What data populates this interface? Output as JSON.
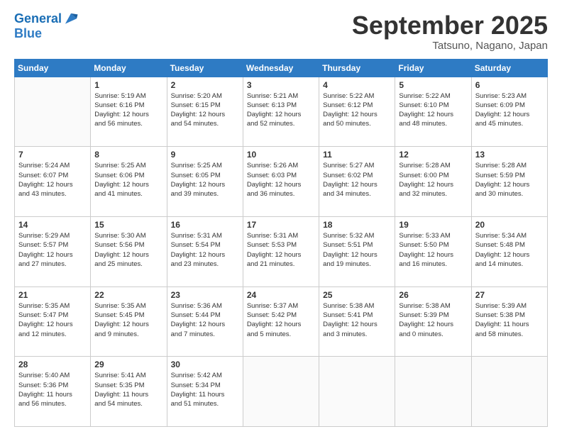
{
  "header": {
    "logo_line1": "General",
    "logo_line2": "Blue",
    "month": "September 2025",
    "location": "Tatsuno, Nagano, Japan"
  },
  "weekdays": [
    "Sunday",
    "Monday",
    "Tuesday",
    "Wednesday",
    "Thursday",
    "Friday",
    "Saturday"
  ],
  "weeks": [
    [
      {
        "day": "",
        "info": ""
      },
      {
        "day": "1",
        "info": "Sunrise: 5:19 AM\nSunset: 6:16 PM\nDaylight: 12 hours\nand 56 minutes."
      },
      {
        "day": "2",
        "info": "Sunrise: 5:20 AM\nSunset: 6:15 PM\nDaylight: 12 hours\nand 54 minutes."
      },
      {
        "day": "3",
        "info": "Sunrise: 5:21 AM\nSunset: 6:13 PM\nDaylight: 12 hours\nand 52 minutes."
      },
      {
        "day": "4",
        "info": "Sunrise: 5:22 AM\nSunset: 6:12 PM\nDaylight: 12 hours\nand 50 minutes."
      },
      {
        "day": "5",
        "info": "Sunrise: 5:22 AM\nSunset: 6:10 PM\nDaylight: 12 hours\nand 48 minutes."
      },
      {
        "day": "6",
        "info": "Sunrise: 5:23 AM\nSunset: 6:09 PM\nDaylight: 12 hours\nand 45 minutes."
      }
    ],
    [
      {
        "day": "7",
        "info": "Sunrise: 5:24 AM\nSunset: 6:07 PM\nDaylight: 12 hours\nand 43 minutes."
      },
      {
        "day": "8",
        "info": "Sunrise: 5:25 AM\nSunset: 6:06 PM\nDaylight: 12 hours\nand 41 minutes."
      },
      {
        "day": "9",
        "info": "Sunrise: 5:25 AM\nSunset: 6:05 PM\nDaylight: 12 hours\nand 39 minutes."
      },
      {
        "day": "10",
        "info": "Sunrise: 5:26 AM\nSunset: 6:03 PM\nDaylight: 12 hours\nand 36 minutes."
      },
      {
        "day": "11",
        "info": "Sunrise: 5:27 AM\nSunset: 6:02 PM\nDaylight: 12 hours\nand 34 minutes."
      },
      {
        "day": "12",
        "info": "Sunrise: 5:28 AM\nSunset: 6:00 PM\nDaylight: 12 hours\nand 32 minutes."
      },
      {
        "day": "13",
        "info": "Sunrise: 5:28 AM\nSunset: 5:59 PM\nDaylight: 12 hours\nand 30 minutes."
      }
    ],
    [
      {
        "day": "14",
        "info": "Sunrise: 5:29 AM\nSunset: 5:57 PM\nDaylight: 12 hours\nand 27 minutes."
      },
      {
        "day": "15",
        "info": "Sunrise: 5:30 AM\nSunset: 5:56 PM\nDaylight: 12 hours\nand 25 minutes."
      },
      {
        "day": "16",
        "info": "Sunrise: 5:31 AM\nSunset: 5:54 PM\nDaylight: 12 hours\nand 23 minutes."
      },
      {
        "day": "17",
        "info": "Sunrise: 5:31 AM\nSunset: 5:53 PM\nDaylight: 12 hours\nand 21 minutes."
      },
      {
        "day": "18",
        "info": "Sunrise: 5:32 AM\nSunset: 5:51 PM\nDaylight: 12 hours\nand 19 minutes."
      },
      {
        "day": "19",
        "info": "Sunrise: 5:33 AM\nSunset: 5:50 PM\nDaylight: 12 hours\nand 16 minutes."
      },
      {
        "day": "20",
        "info": "Sunrise: 5:34 AM\nSunset: 5:48 PM\nDaylight: 12 hours\nand 14 minutes."
      }
    ],
    [
      {
        "day": "21",
        "info": "Sunrise: 5:35 AM\nSunset: 5:47 PM\nDaylight: 12 hours\nand 12 minutes."
      },
      {
        "day": "22",
        "info": "Sunrise: 5:35 AM\nSunset: 5:45 PM\nDaylight: 12 hours\nand 9 minutes."
      },
      {
        "day": "23",
        "info": "Sunrise: 5:36 AM\nSunset: 5:44 PM\nDaylight: 12 hours\nand 7 minutes."
      },
      {
        "day": "24",
        "info": "Sunrise: 5:37 AM\nSunset: 5:42 PM\nDaylight: 12 hours\nand 5 minutes."
      },
      {
        "day": "25",
        "info": "Sunrise: 5:38 AM\nSunset: 5:41 PM\nDaylight: 12 hours\nand 3 minutes."
      },
      {
        "day": "26",
        "info": "Sunrise: 5:38 AM\nSunset: 5:39 PM\nDaylight: 12 hours\nand 0 minutes."
      },
      {
        "day": "27",
        "info": "Sunrise: 5:39 AM\nSunset: 5:38 PM\nDaylight: 11 hours\nand 58 minutes."
      }
    ],
    [
      {
        "day": "28",
        "info": "Sunrise: 5:40 AM\nSunset: 5:36 PM\nDaylight: 11 hours\nand 56 minutes."
      },
      {
        "day": "29",
        "info": "Sunrise: 5:41 AM\nSunset: 5:35 PM\nDaylight: 11 hours\nand 54 minutes."
      },
      {
        "day": "30",
        "info": "Sunrise: 5:42 AM\nSunset: 5:34 PM\nDaylight: 11 hours\nand 51 minutes."
      },
      {
        "day": "",
        "info": ""
      },
      {
        "day": "",
        "info": ""
      },
      {
        "day": "",
        "info": ""
      },
      {
        "day": "",
        "info": ""
      }
    ]
  ]
}
